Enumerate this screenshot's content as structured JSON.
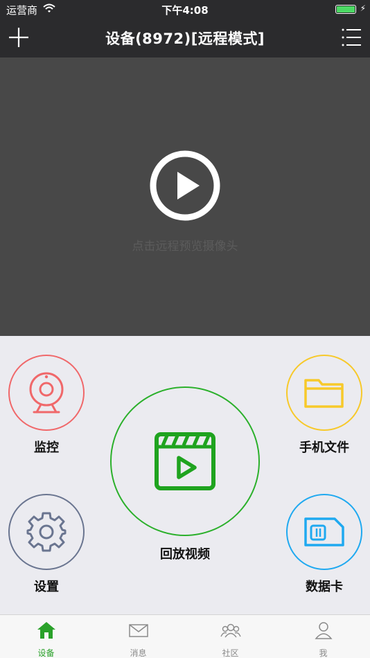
{
  "status_bar": {
    "carrier": "运营商",
    "time": "下午4:08"
  },
  "nav": {
    "title": "设备(8972)[远程模式]",
    "add_icon": "plus-icon",
    "menu_icon": "list-menu-icon"
  },
  "video": {
    "hint": "点击远程预览摄像头",
    "play_icon": "play-circle-icon"
  },
  "functions": {
    "monitor": {
      "label": "监控",
      "color": "#f0686a"
    },
    "phone_files": {
      "label": "手机文件",
      "color": "#f7c92a"
    },
    "playback": {
      "label": "回放视频",
      "color": "#2bb02b"
    },
    "settings": {
      "label": "设置",
      "color": "#6a7590"
    },
    "data_card": {
      "label": "数据卡",
      "color": "#1fa9f0"
    }
  },
  "tabs": [
    {
      "label": "设备",
      "icon": "home-icon",
      "active": true
    },
    {
      "label": "消息",
      "icon": "mail-icon",
      "active": false
    },
    {
      "label": "社区",
      "icon": "community-icon",
      "active": false
    },
    {
      "label": "我",
      "icon": "person-icon",
      "active": false
    }
  ],
  "colors": {
    "accent": "#2aa12a",
    "header_bg": "#2b2b2d",
    "video_bg": "#484848"
  }
}
